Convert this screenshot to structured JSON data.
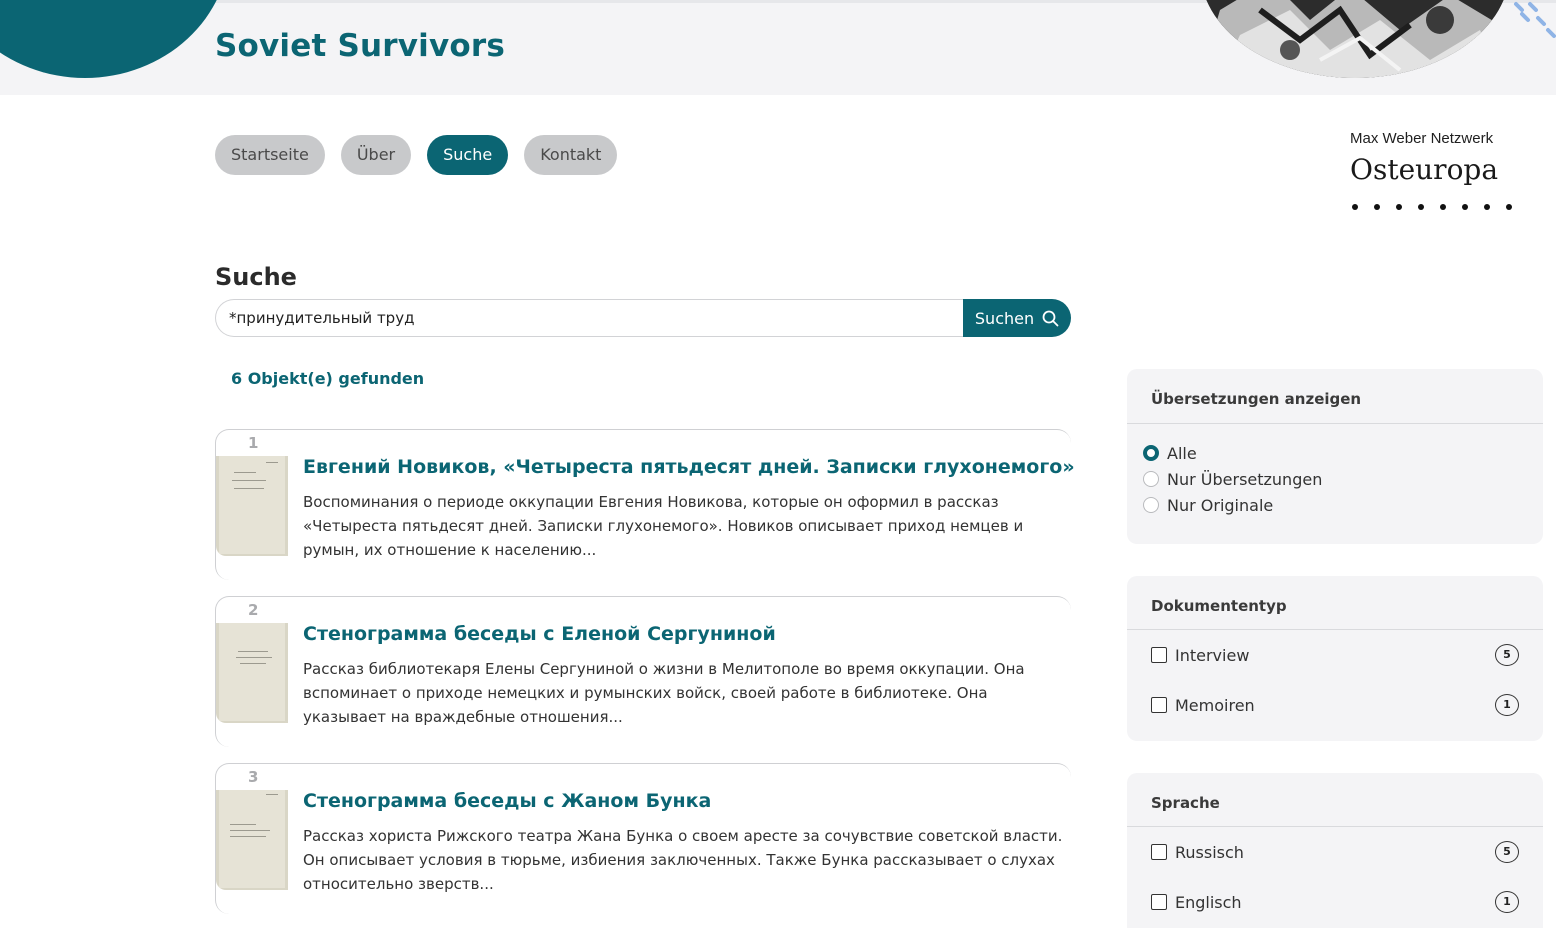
{
  "header": {
    "site_title": "Soviet Survivors",
    "accent_color": "#0b6573"
  },
  "nav": {
    "items": [
      {
        "label": "Startseite",
        "active": false
      },
      {
        "label": "Über",
        "active": false
      },
      {
        "label": "Suche",
        "active": true
      },
      {
        "label": "Kontakt",
        "active": false
      }
    ]
  },
  "brand": {
    "small": "Max Weber Netzwerk",
    "big": "Osteuropa"
  },
  "search": {
    "heading": "Suche",
    "value": "*принудительный труд",
    "button_label": "Suchen",
    "button_icon": "search-icon",
    "result_count": "6 Objekt(e) gefunden"
  },
  "results": [
    {
      "num": "1",
      "title": "Евгений Новиков, «Четыреста пятьдесят дней. Записки глухонемого»",
      "desc": "Воспоминания о периоде оккупации Евгения Новикова, которые он оформил в рассказ «Четыреста пятьдесят дней. Записки глухонемого». Новиков описывает приход немцев и румын, их отношение к населению..."
    },
    {
      "num": "2",
      "title": "Стенограмма беседы с Еленой Сергуниной",
      "desc": "Рассказ библиотекаря Елены Сергуниной о жизни в Мелитополе во время оккупации. Она вспоминает о приходе немецких и румынских войск, своей работе в библиотеке. Она указывает на враждебные отношения..."
    },
    {
      "num": "3",
      "title": "Стенограмма беседы с Жаном Бунка",
      "desc": "Рассказ хориста Рижского театра Жана Бунка о своем аресте за сочувствие советской власти. Он описывает условия в тюрьме, избиения заключенных. Также Бунка рассказывает о слухах относительно зверств..."
    }
  ],
  "sidebar": {
    "translations": {
      "heading": "Übersetzungen anzeigen",
      "options": [
        {
          "label": "Alle",
          "checked": true
        },
        {
          "label": "Nur Übersetzungen",
          "checked": false
        },
        {
          "label": "Nur Originale",
          "checked": false
        }
      ]
    },
    "doctype": {
      "heading": "Dokumententyp",
      "options": [
        {
          "label": "Interview",
          "count": "5"
        },
        {
          "label": "Memoiren",
          "count": "1"
        }
      ]
    },
    "language": {
      "heading": "Sprache",
      "options": [
        {
          "label": "Russisch",
          "count": "5"
        },
        {
          "label": "Englisch",
          "count": "1"
        }
      ]
    }
  }
}
